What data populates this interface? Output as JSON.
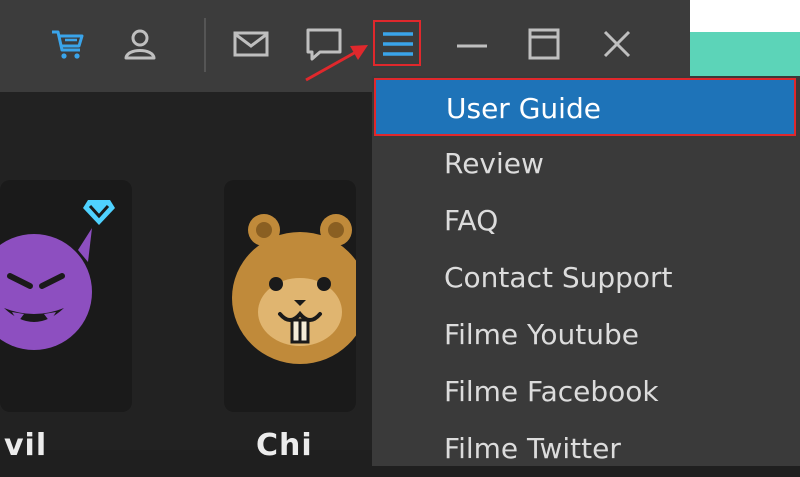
{
  "window": {
    "toolbar_icons": [
      "cart-icon",
      "user-icon",
      "mail-icon",
      "chat-icon",
      "menu-icon",
      "minimize-icon",
      "maximize-icon",
      "close-icon"
    ]
  },
  "colors": {
    "titlebar": "#3c3c3c",
    "content": "#222222",
    "dropdown": "#3a3a3a",
    "active_item": "#1e73b8",
    "highlight": "#e0282c",
    "cart_blue": "#3aa4ea",
    "menu_blue": "#3aa4ea",
    "avatar_purple": "#8d4fc0",
    "avatar_gold": "#c08a3a"
  },
  "menu": {
    "items": [
      {
        "label": "User Guide",
        "active": true
      },
      {
        "label": "Review",
        "active": false
      },
      {
        "label": "FAQ",
        "active": false
      },
      {
        "label": "Contact Support",
        "active": false
      },
      {
        "label": "Filme Youtube",
        "active": false
      },
      {
        "label": "Filme Facebook",
        "active": false
      },
      {
        "label": "Filme Twitter",
        "active": false
      }
    ]
  },
  "cards": [
    {
      "icon": "purple-devil-avatar-icon",
      "badge": "diamond-icon",
      "label": "vil"
    },
    {
      "icon": "hamster-avatar-icon",
      "label": "Chi"
    }
  ]
}
